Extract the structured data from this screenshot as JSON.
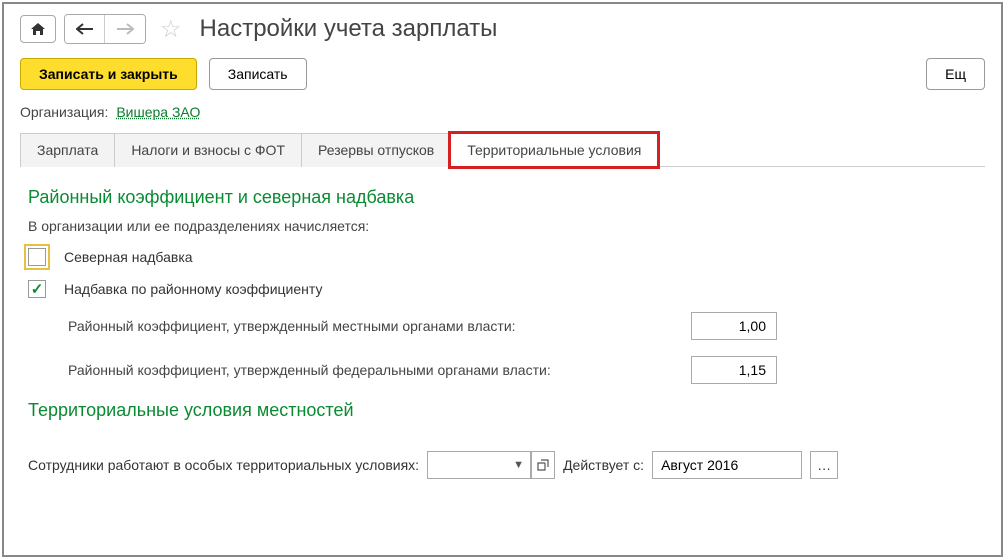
{
  "header": {
    "title": "Настройки учета зарплаты"
  },
  "toolbar": {
    "save_close": "Записать и закрыть",
    "save": "Записать",
    "more": "Ещ"
  },
  "org": {
    "label": "Организация:",
    "value": "Вишера ЗАО"
  },
  "tabs": [
    {
      "label": "Зарплата"
    },
    {
      "label": "Налоги и взносы с ФОТ"
    },
    {
      "label": "Резервы отпусков"
    },
    {
      "label": "Территориальные условия"
    }
  ],
  "section1": {
    "title": "Районный коэффициент и северная надбавка",
    "subtitle": "В организации или ее подразделениях начисляется:",
    "check1": "Северная надбавка",
    "check2": "Надбавка по районному коэффициенту",
    "coef1_label": "Районный коэффициент, утвержденный местными органами власти:",
    "coef1_value": "1,00",
    "coef2_label": "Районный коэффициент, утвержденный федеральными органами власти:",
    "coef2_value": "1,15"
  },
  "section2": {
    "title": "Территориальные условия местностей",
    "row_label": "Сотрудники работают в особых территориальных условиях:",
    "territory_value": "",
    "date_label": "Действует с:",
    "date_value": "Август 2016"
  }
}
